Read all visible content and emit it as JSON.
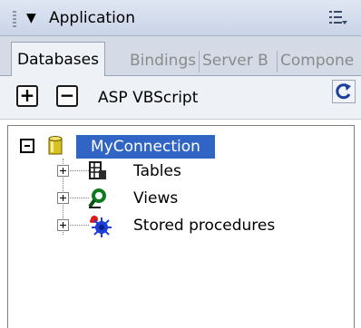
{
  "panel": {
    "title": "Application"
  },
  "tabs": [
    {
      "label": "Databases",
      "active": true
    },
    {
      "label": "Bindings",
      "active": false
    },
    {
      "label": "Server B",
      "active": false
    },
    {
      "label": "Compone",
      "active": false
    }
  ],
  "toolbar": {
    "add_symbol": "+",
    "remove_symbol": "−",
    "server_model": "ASP VBScript"
  },
  "tree": {
    "connection": {
      "label": "MyConnection",
      "icon": "database-cylinder-icon",
      "expanded": true,
      "selected": true
    },
    "children": [
      {
        "label": "Tables",
        "icon": "table-icon"
      },
      {
        "label": "Views",
        "icon": "magnifier-icon"
      },
      {
        "label": "Stored procedures",
        "icon": "stored-procedure-icon"
      }
    ]
  },
  "colors": {
    "selection": "#3065c5",
    "header": "#c9d4e8",
    "tab_strip": "#d4dbe7"
  }
}
